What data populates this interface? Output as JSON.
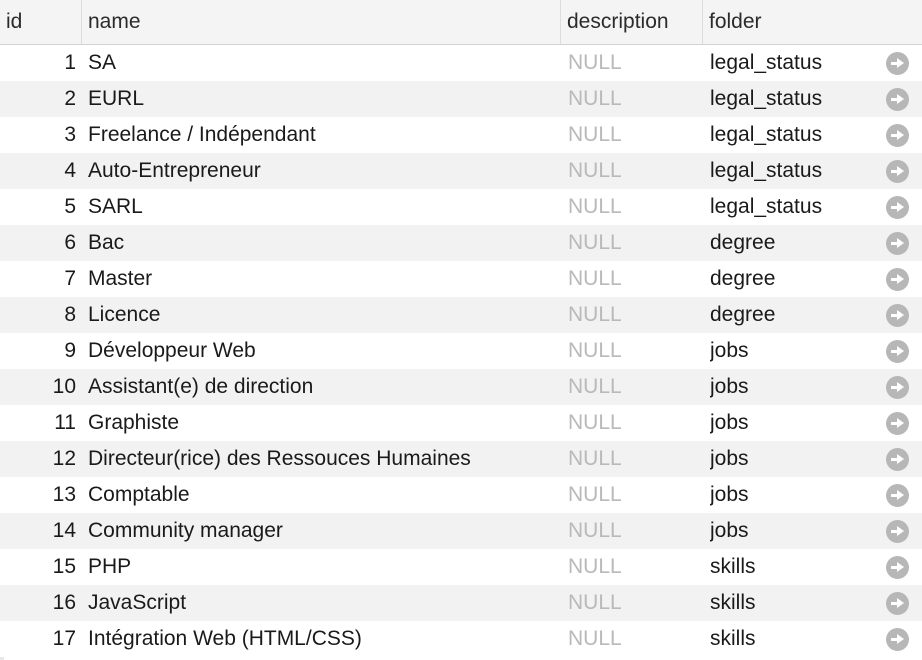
{
  "table": {
    "columns": {
      "id": "id",
      "name": "name",
      "description": "description",
      "folder": "folder"
    },
    "rows": [
      {
        "id": "1",
        "name": "SA",
        "description": "NULL",
        "folder": "legal_status"
      },
      {
        "id": "2",
        "name": "EURL",
        "description": "NULL",
        "folder": "legal_status"
      },
      {
        "id": "3",
        "name": "Freelance / Indépendant",
        "description": "NULL",
        "folder": "legal_status"
      },
      {
        "id": "4",
        "name": "Auto-Entrepreneur",
        "description": "NULL",
        "folder": "legal_status"
      },
      {
        "id": "5",
        "name": "SARL",
        "description": "NULL",
        "folder": "legal_status"
      },
      {
        "id": "6",
        "name": "Bac",
        "description": "NULL",
        "folder": "degree"
      },
      {
        "id": "7",
        "name": "Master",
        "description": "NULL",
        "folder": "degree"
      },
      {
        "id": "8",
        "name": "Licence",
        "description": "NULL",
        "folder": "degree"
      },
      {
        "id": "9",
        "name": "Développeur Web",
        "description": "NULL",
        "folder": "jobs"
      },
      {
        "id": "10",
        "name": "Assistant(e) de direction",
        "description": "NULL",
        "folder": "jobs"
      },
      {
        "id": "11",
        "name": "Graphiste",
        "description": "NULL",
        "folder": "jobs"
      },
      {
        "id": "12",
        "name": "Directeur(rice) des Ressouces Humaines",
        "description": "NULL",
        "folder": "jobs"
      },
      {
        "id": "13",
        "name": "Comptable",
        "description": "NULL",
        "folder": "jobs"
      },
      {
        "id": "14",
        "name": "Community manager",
        "description": "NULL",
        "folder": "jobs"
      },
      {
        "id": "15",
        "name": "PHP",
        "description": "NULL",
        "folder": "skills"
      },
      {
        "id": "16",
        "name": "JavaScript",
        "description": "NULL",
        "folder": "skills"
      },
      {
        "id": "17",
        "name": "Intégration Web (HTML/CSS)",
        "description": "NULL",
        "folder": "skills"
      }
    ],
    "row_action_icon": "arrow-right-circle-icon",
    "colors": {
      "header_bg": "#f4f4f4",
      "alt_row_bg": "#f2f2f2",
      "null_text": "#b9b9b9",
      "action_icon": "#b7b7b7"
    }
  }
}
